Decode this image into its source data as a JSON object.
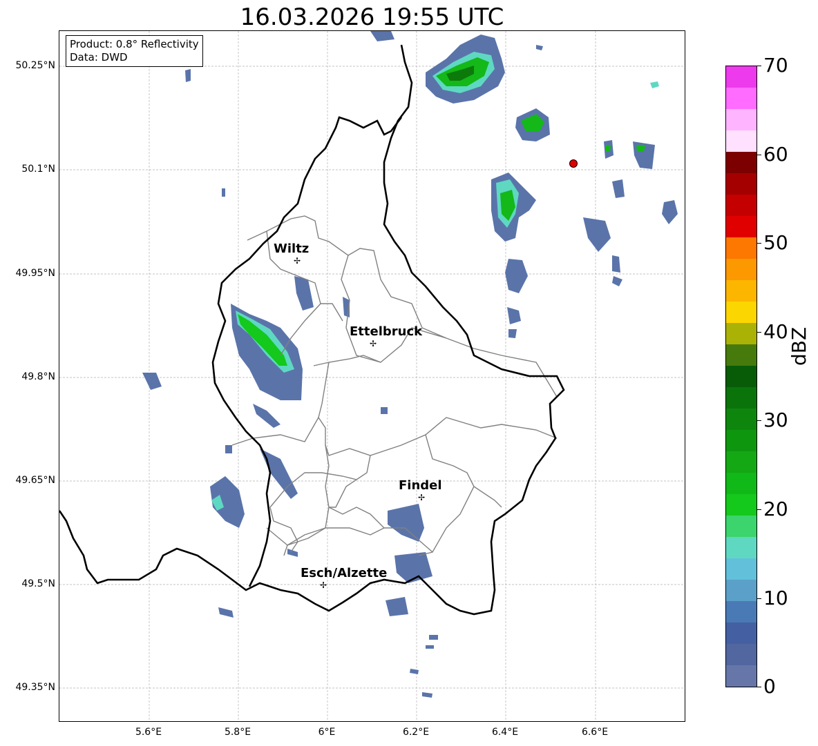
{
  "title": "16.03.2026 19:55 UTC",
  "info_box": {
    "product": "Product: 0.8° Reflectivity",
    "source": "Data: DWD"
  },
  "latitude_ticks": [
    "50.25°N",
    "50.1°N",
    "49.95°N",
    "49.8°N",
    "49.65°N",
    "49.5°N",
    "49.35°N"
  ],
  "longitude_ticks": [
    "5.6°E",
    "5.8°E",
    "6°E",
    "6.2°E",
    "6.4°E",
    "6.6°E"
  ],
  "cities": [
    {
      "name": "Wiltz",
      "lat": 49.966,
      "lon": 5.932
    },
    {
      "name": "Ettelbruck",
      "lat": 49.848,
      "lon": 6.104
    },
    {
      "name": "Findel",
      "lat": 49.627,
      "lon": 6.211
    },
    {
      "name": "Esch/Alzette",
      "lat": 49.499,
      "lon": 5.988
    }
  ],
  "radar_site": {
    "lat": 50.11,
    "lon": 6.548,
    "color": "#e00000"
  },
  "colorbar": {
    "label": "dBZ",
    "ticks": [
      "0",
      "10",
      "20",
      "30",
      "40",
      "50",
      "60",
      "70"
    ],
    "colors": [
      "#6676a8",
      "#5266a0",
      "#4460a2",
      "#4a7ab5",
      "#5aa0c8",
      "#62c0da",
      "#5fd8c2",
      "#3cd46c",
      "#14c81c",
      "#10b818",
      "#14a814",
      "#0f960f",
      "#0e860e",
      "#0a740a",
      "#085c08",
      "#467a0c",
      "#aab206",
      "#fcd600",
      "#fcb600",
      "#fc9800",
      "#fc7800",
      "#e00000",
      "#c40000",
      "#a40000",
      "#7c0000",
      "#ffe0ff",
      "#ffb4ff",
      "#ff6cff",
      "#ec3aec"
    ]
  },
  "colors": {
    "border_country": "#000000",
    "border_canton": "#808080"
  }
}
